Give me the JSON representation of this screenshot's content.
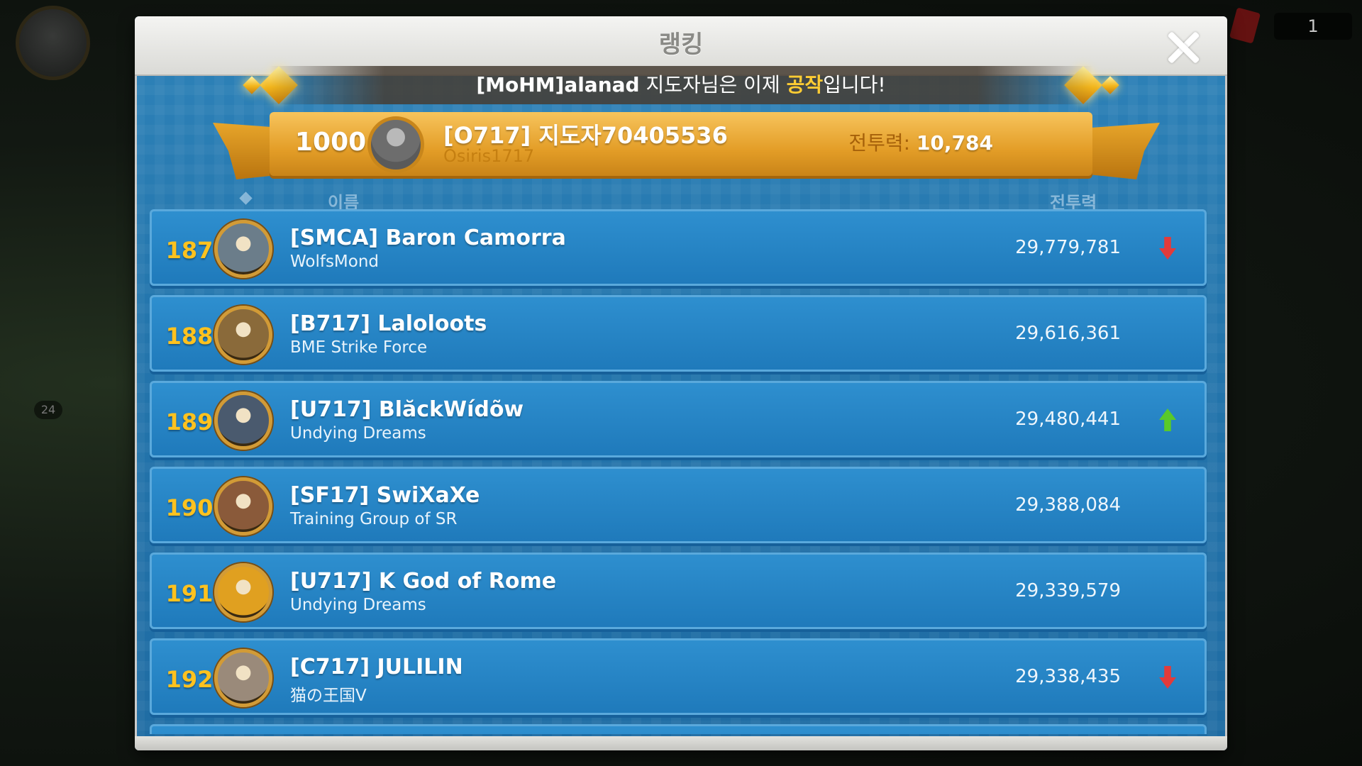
{
  "title": "랭킹",
  "announcement": {
    "name": "[MoHM]alanad",
    "text_before": " 지도자님은 이제 ",
    "highlight": "공작",
    "text_after": "입니다!"
  },
  "my_rank": {
    "rank": "1000+",
    "name": "[O717] 지도자70405536",
    "alliance": "Osiris1717",
    "power_label": "전투력:",
    "power_value": "10,784"
  },
  "columns": {
    "name": "이름",
    "power": "전투력"
  },
  "background": {
    "counter": "1",
    "level": "24"
  },
  "rows": [
    {
      "rank": "187",
      "name": "[SMCA] Baron Camorra",
      "alliance": "WolfsMond",
      "power": "29,779,781",
      "trend": "down",
      "avatar_color": "#6b7d8a"
    },
    {
      "rank": "188",
      "name": "[B717] Laloloots",
      "alliance": "BME Strike Force",
      "power": "29,616,361",
      "trend": "none",
      "avatar_color": "#8a6a3a"
    },
    {
      "rank": "189",
      "name": "[U717] BlăckWídõw",
      "alliance": "Undying Dreams",
      "power": "29,480,441",
      "trend": "up",
      "avatar_color": "#4a5a6e"
    },
    {
      "rank": "190",
      "name": "[SF17] SwiXaXe",
      "alliance": "Training Group of SR",
      "power": "29,388,084",
      "trend": "none",
      "avatar_color": "#8a5a3a"
    },
    {
      "rank": "191",
      "name": "[U717] K God of Rome",
      "alliance": "Undying Dreams",
      "power": "29,339,579",
      "trend": "none",
      "avatar_color": "#e0a020"
    },
    {
      "rank": "192",
      "name": "[C717] JULILIN",
      "alliance": "猫の王国V",
      "power": "29,338,435",
      "trend": "down",
      "avatar_color": "#9a8a7a"
    }
  ]
}
